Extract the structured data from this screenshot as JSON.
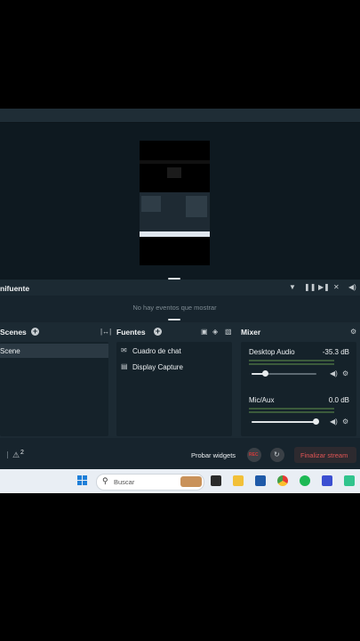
{
  "events": {
    "title": "nifuente",
    "empty_text": "No hay eventos que mostrar"
  },
  "scenes": {
    "title": "Scenes",
    "items": [
      "Scene"
    ]
  },
  "sources": {
    "title": "Fuentes",
    "items": [
      {
        "label": "Cuadro de chat",
        "icon": "chat-icon"
      },
      {
        "label": "Display Capture",
        "icon": "monitor-icon"
      }
    ]
  },
  "mixer": {
    "title": "Mixer",
    "channels": [
      {
        "name": "Desktop Audio",
        "level": "-35.3 dB",
        "volume_fraction": 0.18
      },
      {
        "name": "Mic/Aux",
        "level": "0.0 dB",
        "volume_fraction": 1.0
      }
    ]
  },
  "bottom": {
    "notification_count": "2",
    "test_widgets": "Probar widgets",
    "rec_label": "REC",
    "end_stream": "Finalizar stream"
  },
  "taskbar": {
    "search_placeholder": "Buscar"
  },
  "colors": {
    "accent_red": "#d33a3a",
    "background": "#17242d",
    "panel": "#15222a"
  }
}
